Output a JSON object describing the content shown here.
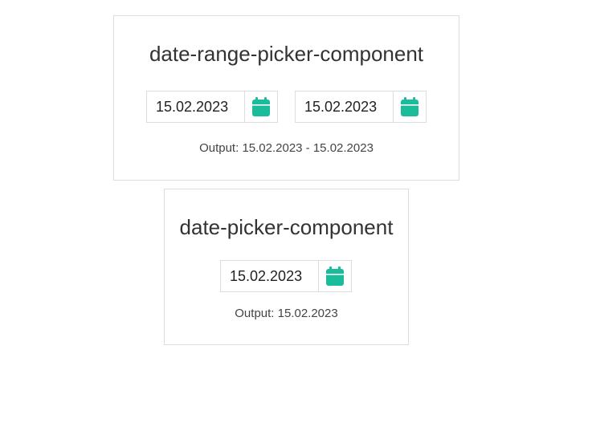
{
  "colors": {
    "accent": "#1abc9c",
    "border": "#dddddd",
    "text": "#333333"
  },
  "range_picker": {
    "title": "date-range-picker-component",
    "from_value": "15.02.2023",
    "to_value": "15.02.2023",
    "calendar_icon": "calendar-icon",
    "output_label": "Output:",
    "output_value": "15.02.2023 - 15.02.2023"
  },
  "single_picker": {
    "title": "date-picker-component",
    "value": "15.02.2023",
    "calendar_icon": "calendar-icon",
    "output_label": "Output:",
    "output_value": "15.02.2023"
  }
}
